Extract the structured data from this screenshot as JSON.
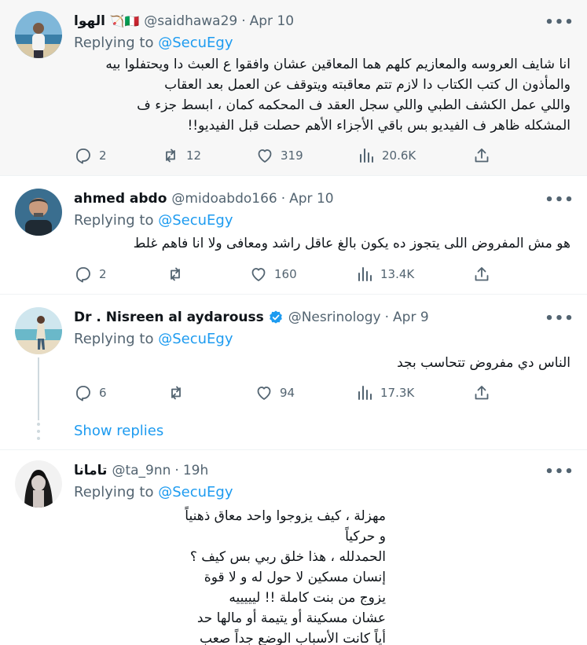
{
  "tweets": [
    {
      "name": "الهوا",
      "flags": "🏹🇮🇹",
      "handle": "@saidhawa29",
      "date": "Apr 10",
      "replying_prefix": "Replying to",
      "replying_to": "@SecuEgy",
      "lines": [
        "انا شايف العروسه والمعازيم كلهم هما المعاقين عشان وافقوا ع العبث دا ويحتفلوا بيه",
        "والمأذون ال كتب الكتاب دا لازم تتم معاقبته ويتوقف عن العمل بعد العقاب",
        "واللي عمل الكشف الطبي واللي سجل العقد ف المحكمه كمان ، ابسط جزء ف",
        "المشكله ظاهر ف الفيديو بس باقي الأجزاء الأهم حصلت قبل الفيديو!!"
      ],
      "replies": "2",
      "reposts": "12",
      "likes": "319",
      "views": "20.6K"
    },
    {
      "name": "ahmed abdo",
      "handle": "@midoabdo166",
      "date": "Apr 10",
      "replying_prefix": "Replying to",
      "replying_to": "@SecuEgy",
      "lines": [
        "هو مش المفروض اللى يتجوز ده يكون بالغ عاقل راشد ومعافى ولا انا فاهم غلط"
      ],
      "replies": "2",
      "reposts": "",
      "likes": "160",
      "views": "13.4K"
    },
    {
      "name": "Dr . Nisreen al aydarouss",
      "handle": "@Nesrinology",
      "date": "Apr 9",
      "replying_prefix": "Replying to",
      "replying_to": "@SecuEgy",
      "lines": [
        "الناس دي مفروض تتحاسب بجد"
      ],
      "replies": "6",
      "reposts": "",
      "likes": "94",
      "views": "17.3K",
      "show_replies": "Show replies"
    },
    {
      "name": "تامانا",
      "handle": "@ta_9nn",
      "date": "19h",
      "replying_prefix": "Replying to",
      "replying_to": "@SecuEgy",
      "lines": [
        "مهزلة ، كيف يزوجوا واحد معاق ذهنياً",
        "و حركياً",
        "الحمدلله ، هذا خلق ربي بس كيف ؟",
        "إنسان مسكين لا حول له و لا قوة",
        "يزوج من بنت كاملة !! ليييييه",
        "عشان مسكينة أو يتيمة أو مالها حد",
        "أياً كانت الأسباب الوضع جداً صعب"
      ]
    }
  ],
  "colors": {
    "accent": "#1d9bf0",
    "secondary": "#536471",
    "text": "#0f1419"
  },
  "icons": [
    "reply-icon",
    "repost-icon",
    "like-icon",
    "views-icon",
    "share-icon",
    "verified-icon",
    "more-icon"
  ]
}
